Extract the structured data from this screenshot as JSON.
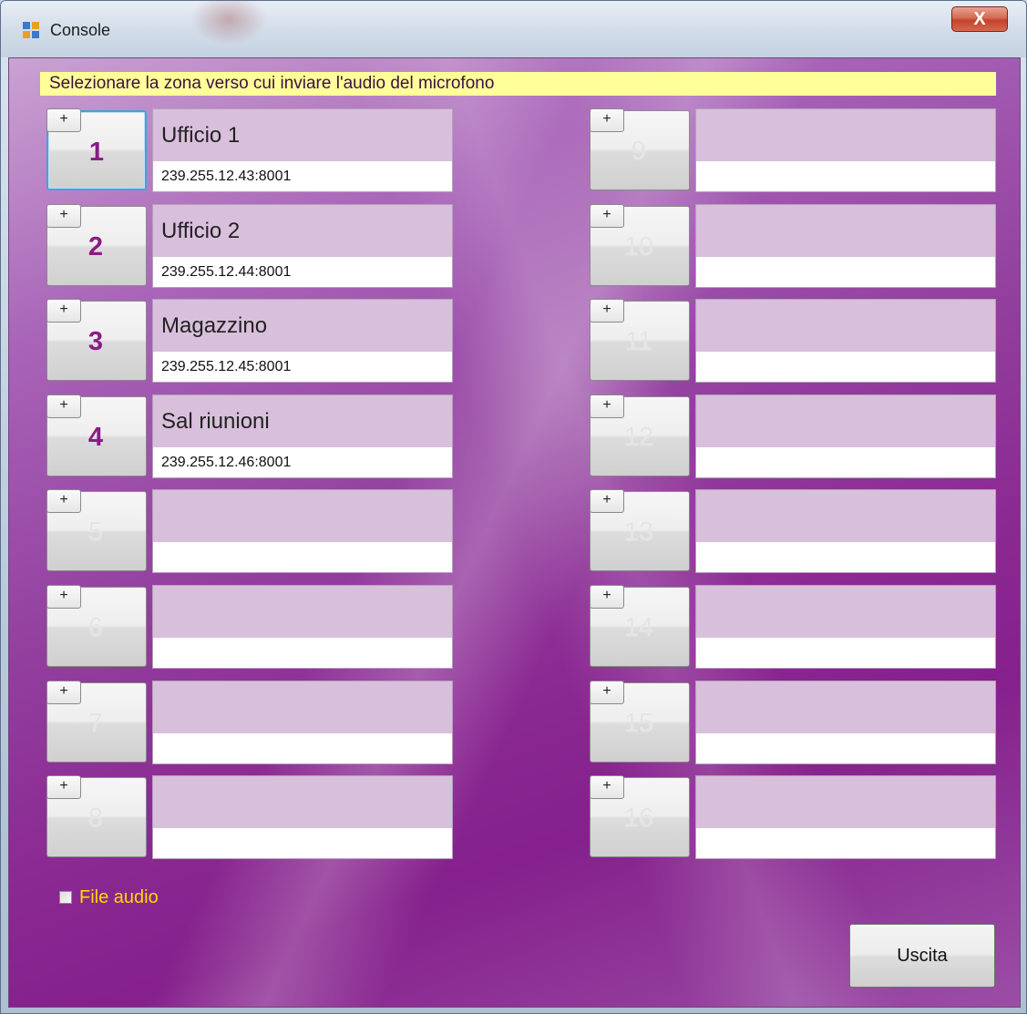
{
  "window": {
    "title": "Console",
    "close_label": "X"
  },
  "banner": "Selezionare la zona verso cui inviare l'audio del microfono",
  "zones": [
    {
      "number": "1",
      "name": "Ufficio 1",
      "address": "239.255.12.43:8001",
      "plus": "+",
      "active": true,
      "focused": true
    },
    {
      "number": "2",
      "name": "Ufficio 2",
      "address": "239.255.12.44:8001",
      "plus": "+",
      "active": true,
      "focused": false
    },
    {
      "number": "3",
      "name": "Magazzino",
      "address": "239.255.12.45:8001",
      "plus": "+",
      "active": true,
      "focused": false
    },
    {
      "number": "4",
      "name": "Sal riunioni",
      "address": "239.255.12.46:8001",
      "plus": "+",
      "active": true,
      "focused": false
    },
    {
      "number": "5",
      "name": "",
      "address": "",
      "plus": "+",
      "active": false,
      "focused": false
    },
    {
      "number": "6",
      "name": "",
      "address": "",
      "plus": "+",
      "active": false,
      "focused": false
    },
    {
      "number": "7",
      "name": "",
      "address": "",
      "plus": "+",
      "active": false,
      "focused": false
    },
    {
      "number": "8",
      "name": "",
      "address": "",
      "plus": "+",
      "active": false,
      "focused": false
    },
    {
      "number": "9",
      "name": "",
      "address": "",
      "plus": "+",
      "active": false,
      "focused": false
    },
    {
      "number": "10",
      "name": "",
      "address": "",
      "plus": "+",
      "active": false,
      "focused": false
    },
    {
      "number": "11",
      "name": "",
      "address": "",
      "plus": "+",
      "active": false,
      "focused": false
    },
    {
      "number": "12",
      "name": "",
      "address": "",
      "plus": "+",
      "active": false,
      "focused": false
    },
    {
      "number": "13",
      "name": "",
      "address": "",
      "plus": "+",
      "active": false,
      "focused": false
    },
    {
      "number": "14",
      "name": "",
      "address": "",
      "plus": "+",
      "active": false,
      "focused": false
    },
    {
      "number": "15",
      "name": "",
      "address": "",
      "plus": "+",
      "active": false,
      "focused": false
    },
    {
      "number": "16",
      "name": "",
      "address": "",
      "plus": "+",
      "active": false,
      "focused": false
    }
  ],
  "file_audio": {
    "label": "File audio",
    "checked": false
  },
  "exit_button": "Uscita",
  "colors": {
    "banner_bg": "#ffff99",
    "active_number": "#8a1a86",
    "checkbox_label": "#ffd700",
    "background": "#93409f"
  },
  "icons": {
    "app": "app-window-icon",
    "close": "close-icon"
  }
}
